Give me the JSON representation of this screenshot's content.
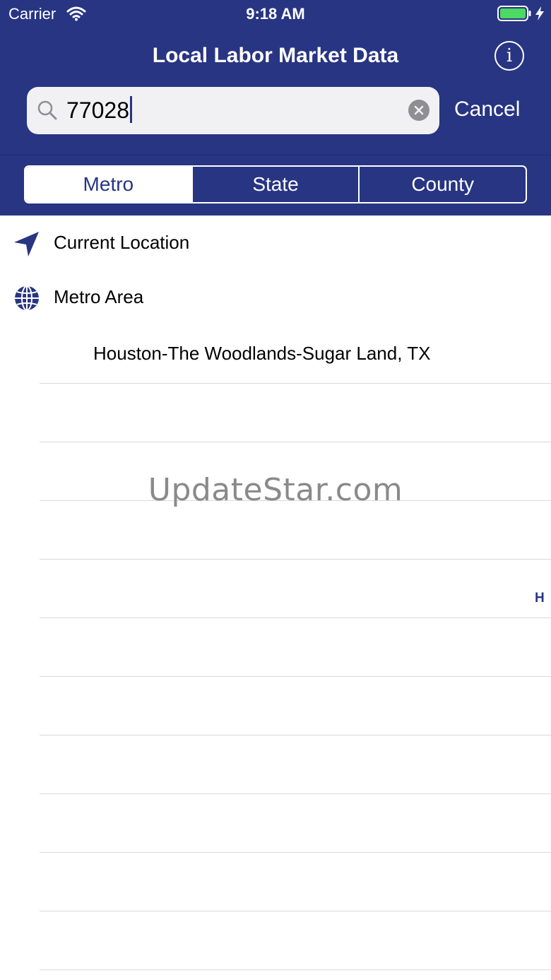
{
  "status_bar": {
    "carrier": "Carrier",
    "time": "9:18 AM",
    "battery_color": "#4cd964"
  },
  "nav": {
    "title": "Local Labor Market Data",
    "info_icon": "info-icon"
  },
  "search": {
    "value": "77028",
    "cancel_label": "Cancel"
  },
  "segments": {
    "items": [
      {
        "label": "Metro",
        "selected": true
      },
      {
        "label": "State",
        "selected": false
      },
      {
        "label": "County",
        "selected": false
      }
    ]
  },
  "list": {
    "current_location_label": "Current Location",
    "metro_area_label": "Metro Area",
    "results": [
      "Houston-The Woodlands-Sugar Land, TX"
    ]
  },
  "index": {
    "letters": [
      "H"
    ]
  },
  "watermark": "UpdateStar.com",
  "colors": {
    "brand": "#283583",
    "separator": "#d9d9de"
  }
}
